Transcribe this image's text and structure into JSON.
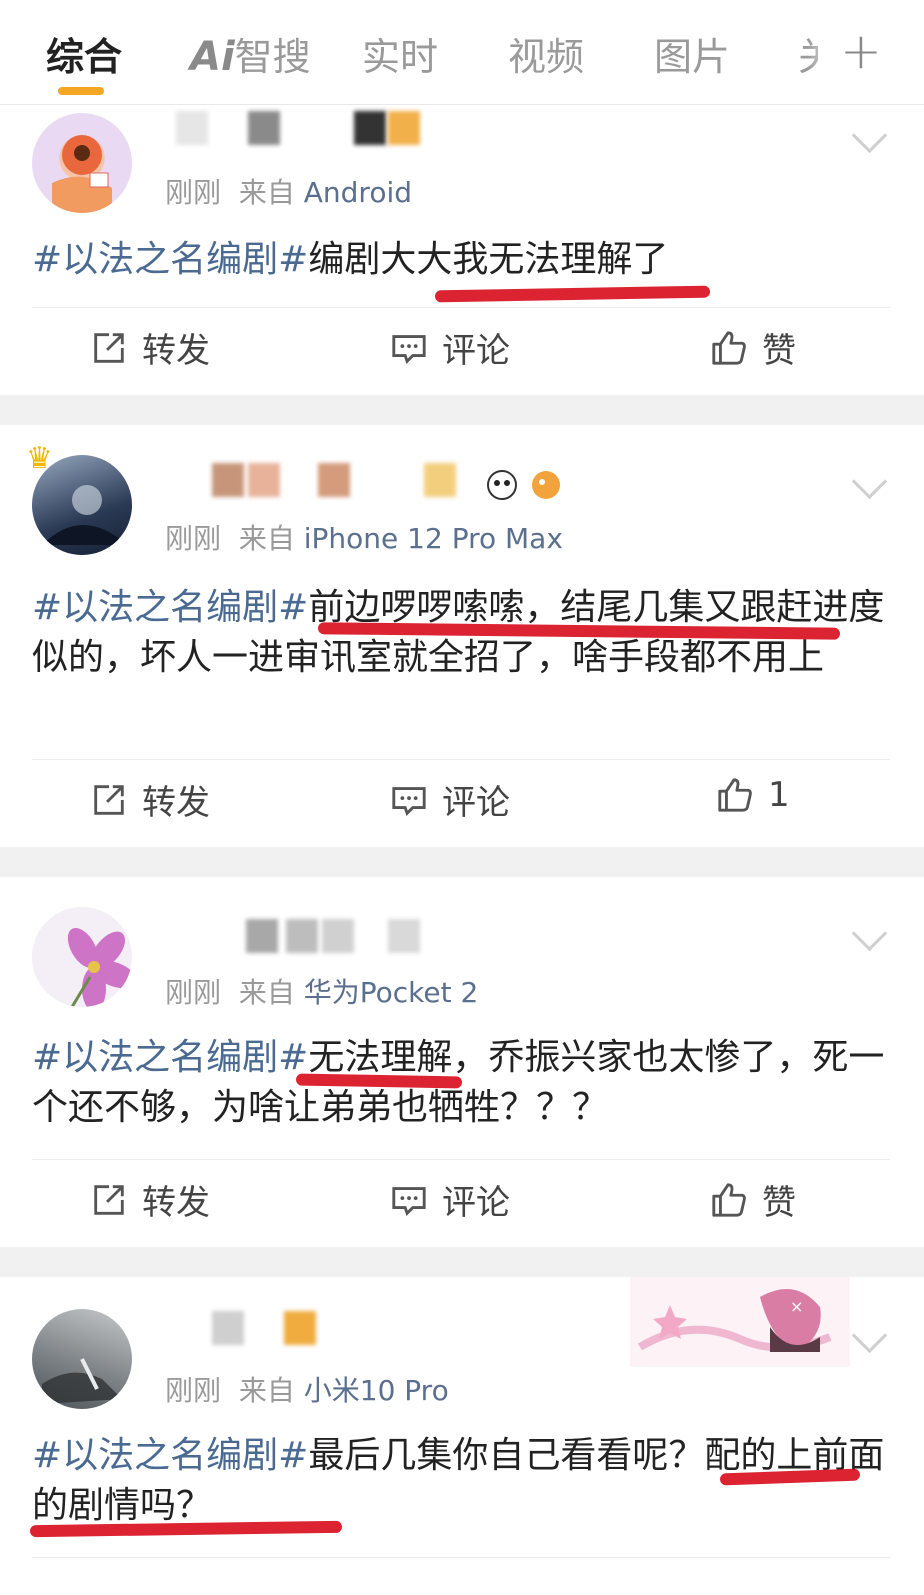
{
  "tabs": [
    "综合",
    "AI智搜",
    "实时",
    "视频",
    "图片",
    "关"
  ],
  "tab_ai_prefix": "Ai",
  "tab_ai_rest": "智搜",
  "plus": "+",
  "posts": [
    {
      "time": "刚刚",
      "from": "来自",
      "source": "Android",
      "tag": "#以法之名编剧#",
      "text": "编剧大大我无法理解了",
      "repost": "转发",
      "comment": "评论",
      "like": "赞"
    },
    {
      "time": "刚刚",
      "from": "来自",
      "source": "iPhone 12 Pro Max",
      "tag": "#以法之名编剧#",
      "text": "前边啰啰嗦嗦，结尾几集又跟赶进度似的，坏人一进审讯室就全招了，啥手段都不用上",
      "repost": "转发",
      "comment": "评论",
      "like": "1"
    },
    {
      "time": "刚刚",
      "from": "来自",
      "source": "华为Pocket 2",
      "tag": "#以法之名编剧#",
      "text": "无法理解，乔振兴家也太惨了，死一个还不够，为啥让弟弟也牺牲？？？",
      "repost": "转发",
      "comment": "评论",
      "like": "赞"
    },
    {
      "time": "刚刚",
      "from": "来自",
      "source": "小米10 Pro",
      "tag": "#以法之名编剧#",
      "text": "最后几集你自己看看呢？配的上前面的剧情吗？"
    }
  ],
  "colors": {
    "accent": "#f5a623",
    "topic": "#4a6a91",
    "underline": "#d8101f"
  },
  "icons": [
    "repost-icon",
    "comment-icon",
    "like-icon",
    "chevron-down-icon",
    "plus-icon"
  ]
}
